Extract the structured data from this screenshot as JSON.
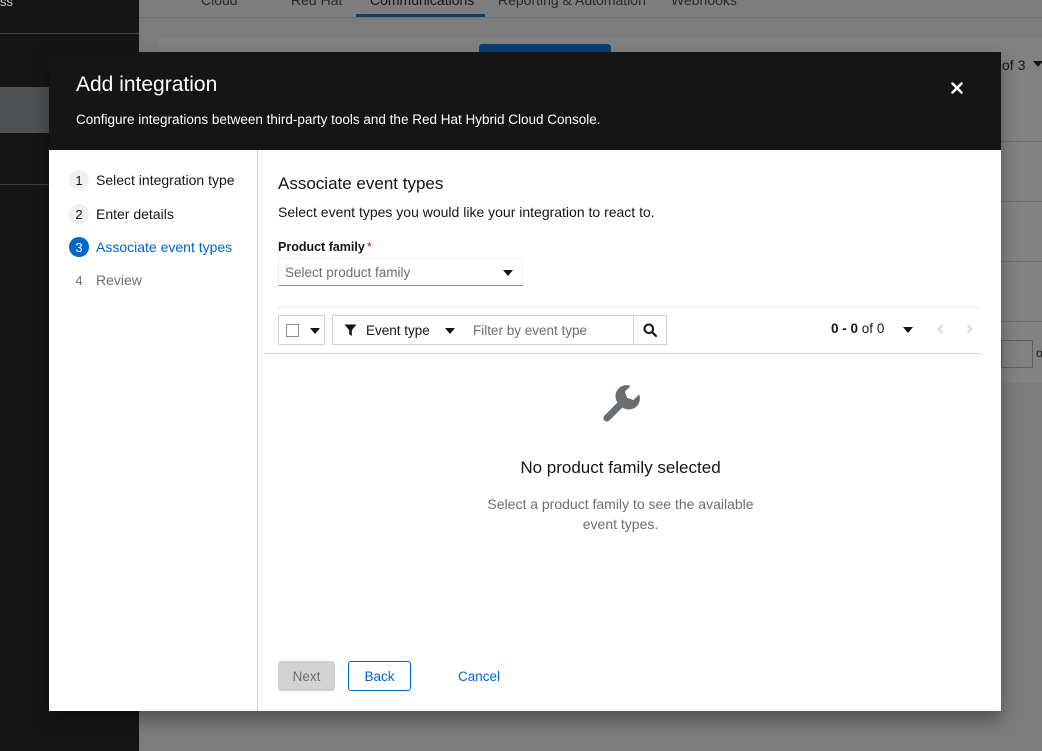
{
  "background": {
    "sidebar_partial_text": "ss",
    "tabs": [
      {
        "label": "Cloud",
        "active": false
      },
      {
        "label": "Red Hat",
        "active": false
      },
      {
        "label": "Communications",
        "active": true
      },
      {
        "label": "Reporting & Automation",
        "active": false
      },
      {
        "label": "Webhooks",
        "active": false
      }
    ],
    "pagination_partial": "of 3",
    "row_partial": "o"
  },
  "modal": {
    "title": "Add integration",
    "description": "Configure integrations between third-party tools and the Red Hat Hybrid Cloud Console.",
    "close_icon": "close-icon"
  },
  "wizard": {
    "steps": [
      {
        "number": "1",
        "label": "Select integration type",
        "state": "visited"
      },
      {
        "number": "2",
        "label": "Enter details",
        "state": "visited"
      },
      {
        "number": "3",
        "label": "Associate event types",
        "state": "current"
      },
      {
        "number": "4",
        "label": "Review",
        "state": "disabled"
      }
    ]
  },
  "step": {
    "title": "Associate event types",
    "description": "Select event types you would like your integration to react to.",
    "product_family": {
      "label": "Product family",
      "required_marker": "*",
      "placeholder": "Select product family",
      "value": ""
    }
  },
  "toolbar": {
    "filter_attribute": "Event type",
    "filter_icon": "filter-icon",
    "search_placeholder": "Filter by event type",
    "search_value": "",
    "search_icon": "search-icon",
    "pagination": {
      "range": "0 - 0",
      "of_label": "of",
      "total": "0"
    }
  },
  "empty_state": {
    "icon": "wrench-icon",
    "title": "No product family selected",
    "body": "Select a product family to see the available event types."
  },
  "footer": {
    "next_label": "Next",
    "back_label": "Back",
    "cancel_label": "Cancel"
  },
  "colors": {
    "header_bg": "#151515",
    "accent": "#0066cc",
    "required": "#c9190b",
    "disabled_bg": "#d2d2d2"
  }
}
